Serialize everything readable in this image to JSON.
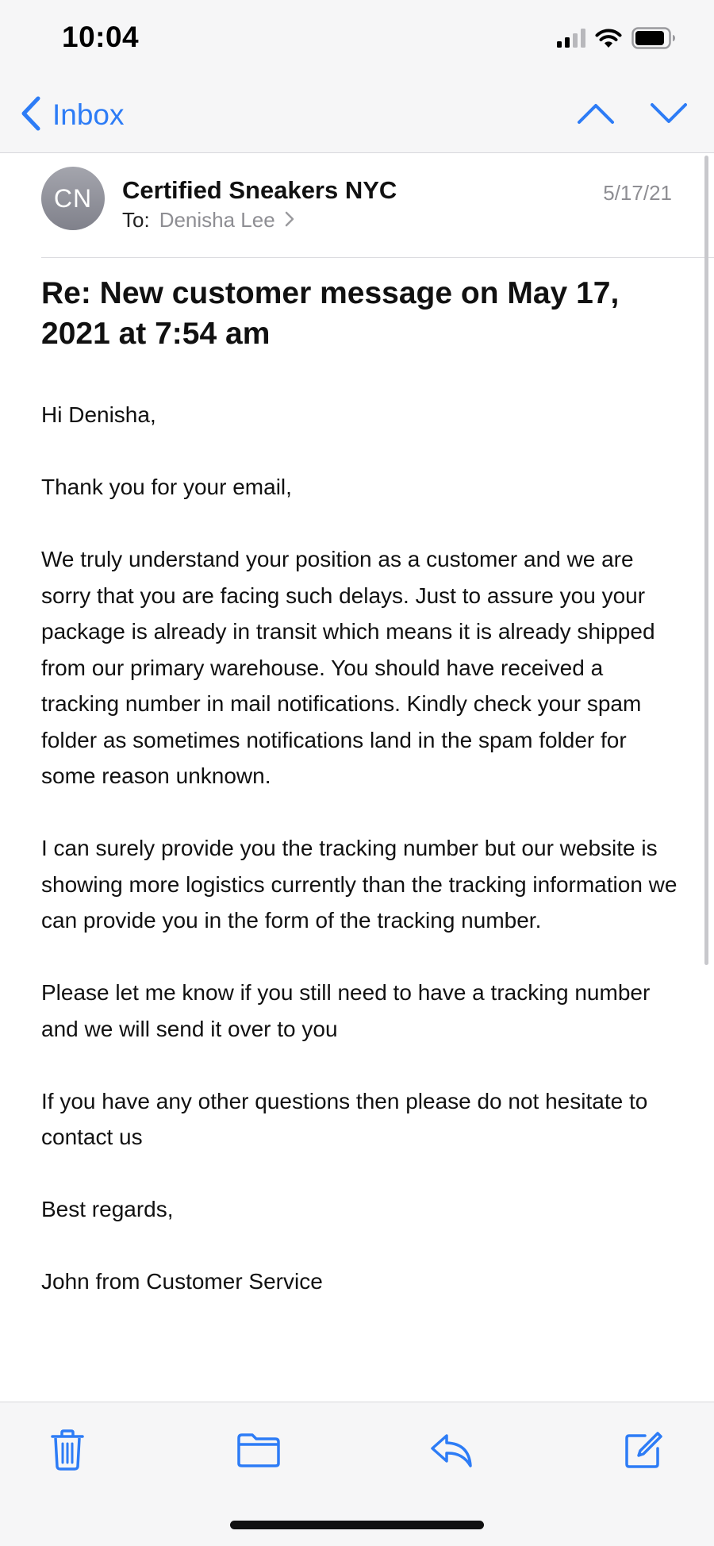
{
  "status_bar": {
    "time": "10:04",
    "icons": [
      "cellular-signal-icon",
      "wifi-icon",
      "battery-icon"
    ]
  },
  "nav": {
    "back_label": "Inbox",
    "back_icon": "chevron-left-icon",
    "prev_icon": "chevron-up-icon",
    "next_icon": "chevron-down-icon",
    "accent_color": "#2d7cf6"
  },
  "email": {
    "avatar_initials": "CN",
    "sender": "Certified Sneakers NYC",
    "to_label": "To:",
    "recipient": "Denisha Lee",
    "date": "5/17/21",
    "subject": "Re: New customer message on May 17, 2021 at 7:54 am",
    "body": [
      "Hi Denisha,",
      "Thank you for your email,",
      "We truly understand your position as a customer and we are sorry that you are facing such delays. Just to assure you your package is already in transit which means it is already shipped from our primary warehouse. You should have received a tracking number in mail notifications. Kindly check your spam folder as sometimes notifications land in the spam folder for some reason unknown.",
      "I can surely provide you the tracking number but our website is showing more logistics currently than the tracking information we can provide you in the form of the tracking number.",
      "Please let me know if you still need to have a tracking number and we will send it over to you",
      "If you have any other questions then please do not hesitate to contact us",
      "Best regards,",
      "John from Customer Service"
    ]
  },
  "toolbar": {
    "items": [
      "trash-icon",
      "folder-icon",
      "reply-icon",
      "compose-icon"
    ]
  }
}
